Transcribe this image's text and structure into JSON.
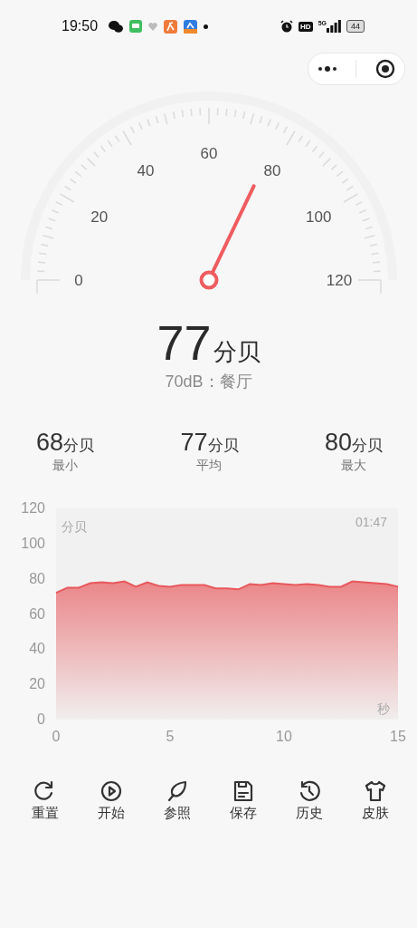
{
  "status_bar": {
    "time": "19:50",
    "hd": "HD",
    "network": "5G",
    "battery": "44"
  },
  "gauge": {
    "scale_labels": [
      "0",
      "20",
      "40",
      "60",
      "80",
      "100",
      "120"
    ]
  },
  "reading": {
    "value": "77",
    "unit": "分贝",
    "reference": "70dB：餐厅"
  },
  "stats": [
    {
      "value": "68",
      "unit": "分贝",
      "label": "最小"
    },
    {
      "value": "77",
      "unit": "分贝",
      "label": "平均"
    },
    {
      "value": "80",
      "unit": "分贝",
      "label": "最大"
    }
  ],
  "chart": {
    "elapsed": "01:47",
    "chart_data": {
      "type": "area",
      "xlabel": "秒",
      "ylabel": "分贝",
      "xlim": [
        0,
        15
      ],
      "ylim": [
        0,
        120
      ],
      "xticks": [
        0,
        5,
        10,
        15
      ],
      "yticks": [
        0,
        20,
        40,
        60,
        80,
        100,
        120
      ],
      "x": [
        0,
        0.5,
        1,
        1.5,
        2,
        2.5,
        3,
        3.5,
        4,
        4.5,
        5,
        5.5,
        6,
        6.5,
        7,
        7.5,
        8,
        8.5,
        9,
        9.5,
        10,
        10.5,
        11,
        11.5,
        12,
        12.5,
        13,
        13.5,
        14,
        14.5,
        15
      ],
      "series": [
        {
          "color": "#e8585c",
          "values": [
            72,
            75,
            75,
            77.5,
            78,
            77.5,
            78.5,
            75.5,
            78,
            76,
            75.5,
            76.5,
            76.5,
            76.5,
            74.5,
            74.5,
            74,
            77,
            76.5,
            77.5,
            77,
            76.5,
            77,
            76.5,
            75.5,
            75.5,
            78.5,
            78,
            77.5,
            77,
            75.5
          ]
        }
      ]
    }
  },
  "toolbar": [
    {
      "kind": "reset",
      "label": "重置"
    },
    {
      "kind": "start",
      "label": "开始"
    },
    {
      "kind": "reference",
      "label": "参照"
    },
    {
      "kind": "save",
      "label": "保存"
    },
    {
      "kind": "history",
      "label": "历史"
    },
    {
      "kind": "skin",
      "label": "皮肤"
    }
  ]
}
